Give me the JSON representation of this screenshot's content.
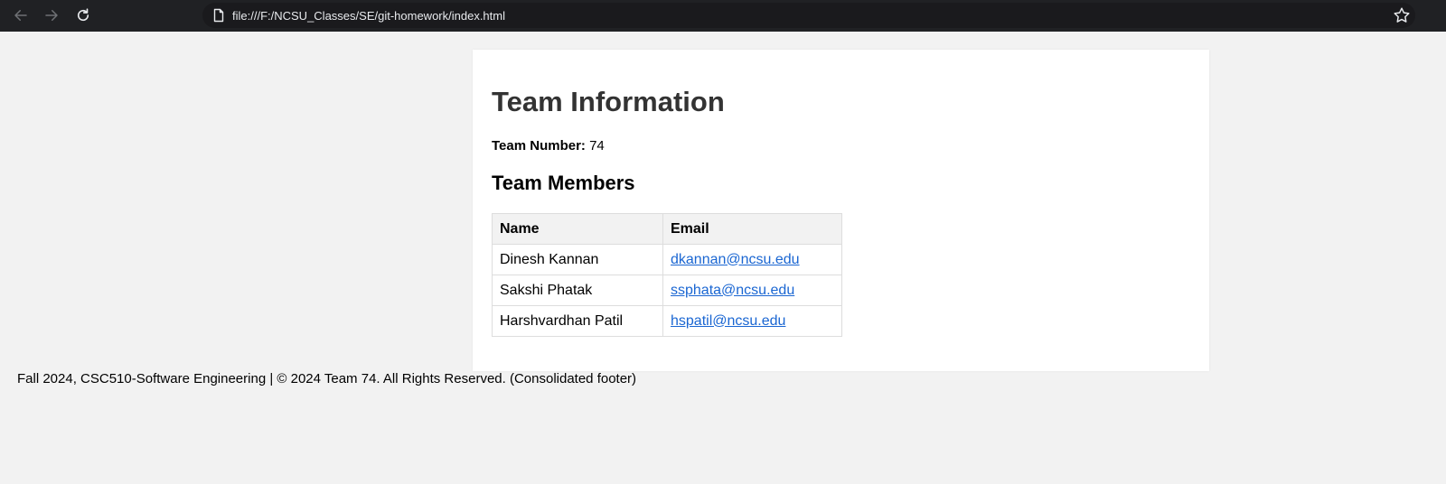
{
  "browser": {
    "url": "file:///F:/NCSU_Classes/SE/git-homework/index.html",
    "icons": {
      "back": "arrow-left-icon",
      "forward": "arrow-right-icon",
      "reload": "reload-icon",
      "page": "page-icon",
      "bookmark": "star-icon"
    }
  },
  "page": {
    "title": "Team Information",
    "team_number_label": "Team Number:",
    "team_number_value": "74",
    "members_heading": "Team Members",
    "table": {
      "headers": [
        "Name",
        "Email"
      ],
      "rows": [
        {
          "name": "Dinesh Kannan",
          "email": "dkannan@ncsu.edu"
        },
        {
          "name": "Sakshi Phatak",
          "email": "ssphata@ncsu.edu"
        },
        {
          "name": "Harshvardhan Patil",
          "email": "hspatil@ncsu.edu"
        }
      ]
    },
    "footer": "Fall 2024, CSC510-Software Engineering | © 2024 Team 74. All Rights Reserved. (Consolidated footer)"
  },
  "colors": {
    "toolbar_bg": "#202124",
    "page_bg": "#f2f2f2",
    "link": "#1a66d2",
    "title": "#333333"
  }
}
